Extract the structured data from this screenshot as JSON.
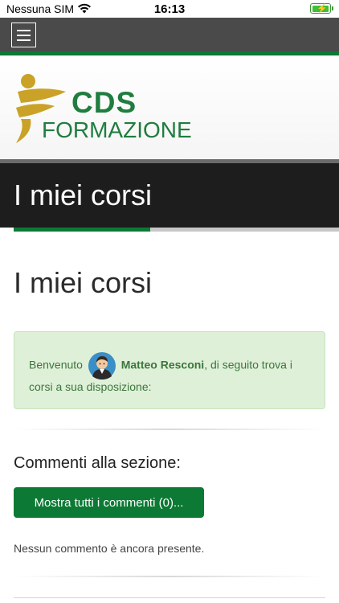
{
  "status_bar": {
    "carrier": "Nessuna SIM",
    "time": "16:13",
    "wifi_icon": "wifi-icon",
    "battery_icon": "battery-charging-icon",
    "battery_color": "#3fbf3a"
  },
  "navbar": {
    "menu_icon": "hamburger-menu-icon",
    "background": "#4a4a4a",
    "accent": "#0c7a34"
  },
  "logo": {
    "line1": "CDS",
    "line2": "FORMAZIONE",
    "brand_green": "#1f7d3f",
    "brand_gold": "#c9a227"
  },
  "title_band": {
    "title": "I miei corsi"
  },
  "page": {
    "title": "I miei corsi"
  },
  "welcome_alert": {
    "prefix": "Benvenuto",
    "user_name": "Matteo Resconi",
    "suffix": ", di seguito trova i",
    "line2": "corsi a sua disposizione:",
    "avatar_icon": "user-avatar-icon",
    "background": "#dff0d8",
    "text_color": "#3c763d"
  },
  "comments": {
    "heading": "Commenti alla sezione:",
    "show_all_button": "Mostra tutti i commenti (0)...",
    "empty_message": "Nessun commento è ancora presente."
  }
}
